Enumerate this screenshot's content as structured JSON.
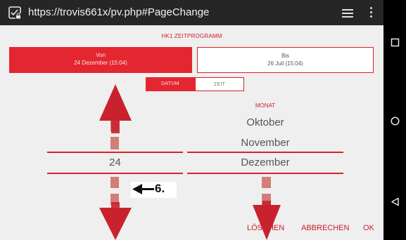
{
  "browser": {
    "url": "https://trovis661x/pv.php#PageChange",
    "icons": [
      "site-info-icon",
      "tabs-icon",
      "overflow-menu-icon"
    ]
  },
  "page": {
    "title": "HK1 ZEITPROGRAMM",
    "from_tile": {
      "label": "Von",
      "value": "24 Dezember (15:04)"
    },
    "to_tile": {
      "label": "Bis",
      "value": "26 Juli (15:04)"
    },
    "mode_tabs": [
      {
        "label": "DATUM",
        "active": true
      },
      {
        "label": "ZEIT",
        "active": false
      }
    ],
    "month_header": "MONAT",
    "day_picker": {
      "selected": "24"
    },
    "month_picker": {
      "items": [
        "Oktober",
        "November",
        "Dezember"
      ],
      "selected": "Dezember"
    },
    "buttons": {
      "delete": "LÖSCHEN",
      "cancel": "ABBRECHEN",
      "ok": "OK"
    }
  },
  "annotation": {
    "label": "6."
  },
  "nav_bar": {
    "icons": [
      "recents-icon",
      "home-icon",
      "back-icon"
    ]
  },
  "colors": {
    "accent": "#e3262f",
    "urlbar": "#262626",
    "background": "#efefef"
  }
}
